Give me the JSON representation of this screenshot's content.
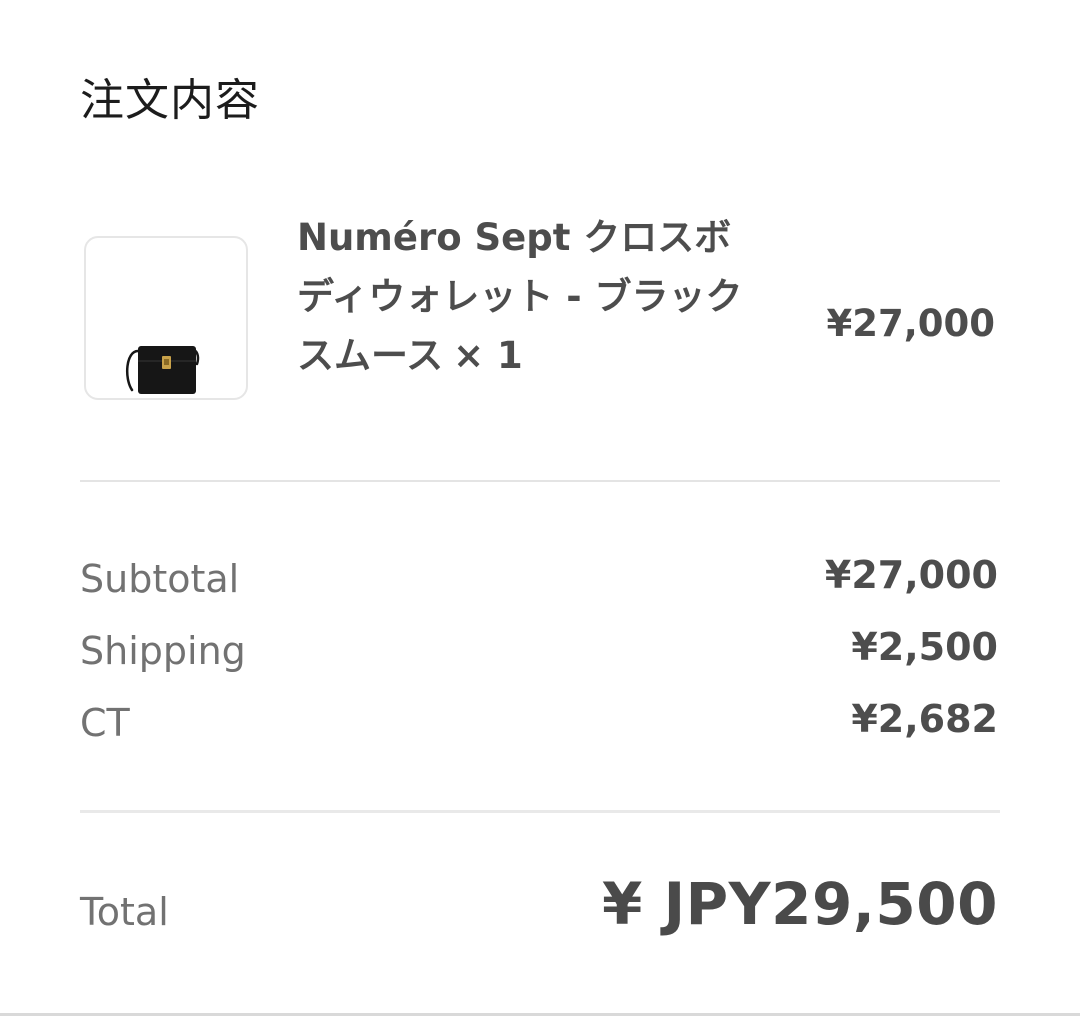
{
  "order": {
    "section_title": "注文内容",
    "item": {
      "image_icon": "crossbody-bag-image",
      "name": "Numéro Sept クロスボディウォレット - ブラック スムース",
      "quantity": "× 1",
      "price": "¥27,000"
    },
    "summary": {
      "subtotal_label": "Subtotal",
      "subtotal_value": "¥27,000",
      "shipping_label": "Shipping",
      "shipping_value": "¥2,500",
      "tax_label": "CT",
      "tax_value": "¥2,682"
    },
    "total": {
      "label": "Total",
      "value": "¥ JPY29,500"
    }
  },
  "colors": {
    "background": "#ffffff",
    "text_dark": "#4d4d4d",
    "text_muted": "#727272",
    "divider": "#e4e4e4",
    "bag": "#161616",
    "clasp": "#c9a24a"
  }
}
